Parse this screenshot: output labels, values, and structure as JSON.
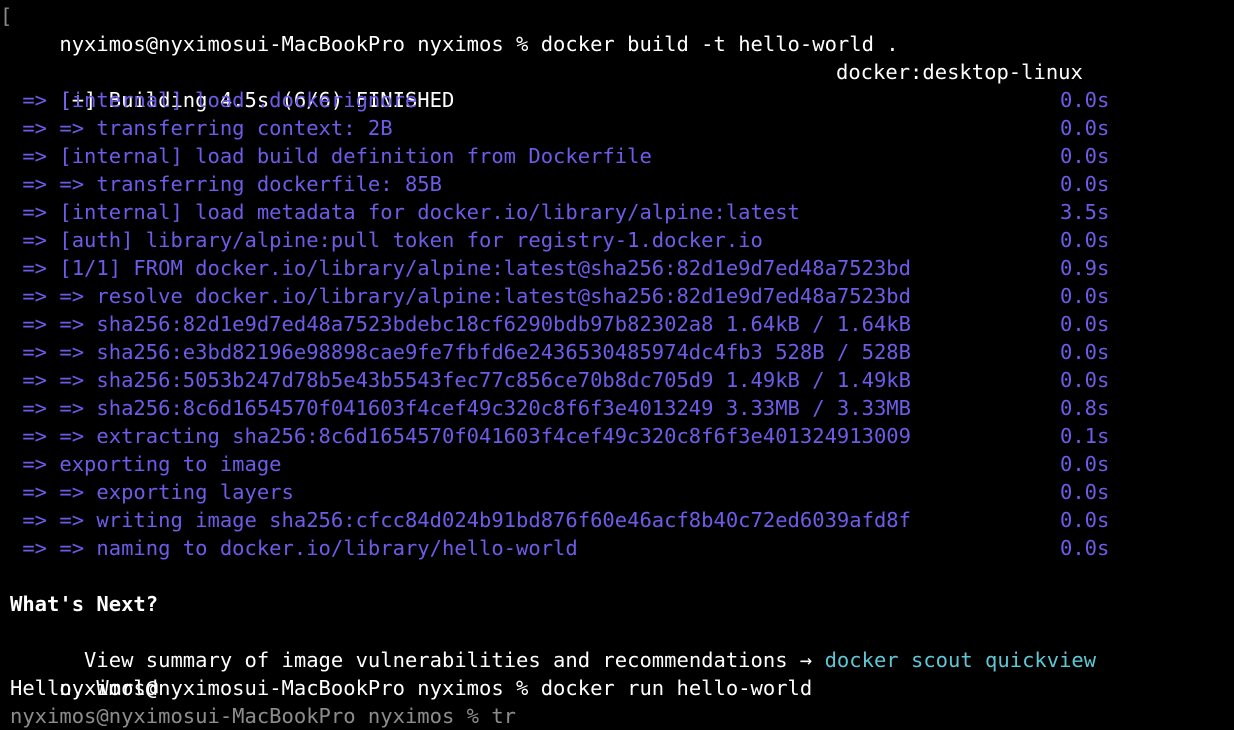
{
  "terminal": {
    "prompt": "nyximos@nyximosui-MacBookPro nyximos % ",
    "commands": {
      "build": "docker build -t hello-world .",
      "run": "docker run hello-world"
    },
    "build_header": {
      "status": "[+] Building 4.5s (6/6) FINISHED",
      "remote": "docker:desktop-linux"
    },
    "steps": [
      {
        "text": " => [internal] load .dockerignore",
        "time": "0.0s"
      },
      {
        "text": " => => transferring context: 2B",
        "time": "0.0s"
      },
      {
        "text": " => [internal] load build definition from Dockerfile",
        "time": "0.0s"
      },
      {
        "text": " => => transferring dockerfile: 85B",
        "time": "0.0s"
      },
      {
        "text": " => [internal] load metadata for docker.io/library/alpine:latest",
        "time": "3.5s"
      },
      {
        "text": " => [auth] library/alpine:pull token for registry-1.docker.io",
        "time": "0.0s"
      },
      {
        "text": " => [1/1] FROM docker.io/library/alpine:latest@sha256:82d1e9d7ed48a7523bd",
        "time": "0.9s"
      },
      {
        "text": " => => resolve docker.io/library/alpine:latest@sha256:82d1e9d7ed48a7523bd",
        "time": "0.0s"
      },
      {
        "text": " => => sha256:82d1e9d7ed48a7523bdebc18cf6290bdb97b82302a8 1.64kB / 1.64kB",
        "time": "0.0s"
      },
      {
        "text": " => => sha256:e3bd82196e98898cae9fe7fbfd6e2436530485974dc4fb3 528B / 528B",
        "time": "0.0s"
      },
      {
        "text": " => => sha256:5053b247d78b5e43b5543fec77c856ce70b8dc705d9 1.49kB / 1.49kB",
        "time": "0.0s"
      },
      {
        "text": " => => sha256:8c6d1654570f041603f4cef49c320c8f6f3e4013249 3.33MB / 3.33MB",
        "time": "0.8s"
      },
      {
        "text": " => => extracting sha256:8c6d1654570f041603f4cef49c320c8f6f3e401324913009",
        "time": "0.1s"
      },
      {
        "text": " => exporting to image",
        "time": "0.0s"
      },
      {
        "text": " => => exporting layers",
        "time": "0.0s"
      },
      {
        "text": " => => writing image sha256:cfcc84d024b91bd876f60e46acf8b40c72ed6039afd8f",
        "time": "0.0s"
      },
      {
        "text": " => => naming to docker.io/library/hello-world",
        "time": "0.0s"
      }
    ],
    "whats_next": {
      "heading": "What's Next?",
      "text": "  View summary of image vulnerabilities and recommendations → ",
      "command": "docker scout quickview"
    },
    "run_output": "Hello, World",
    "partial_line": "nyximos@nyximosui-MacBookPro nyximos % tr",
    "colors": {
      "background": "#000000",
      "text": "#ffffff",
      "step_blue": "#6c5ce7",
      "link_cyan": "#5fc6d4"
    }
  }
}
